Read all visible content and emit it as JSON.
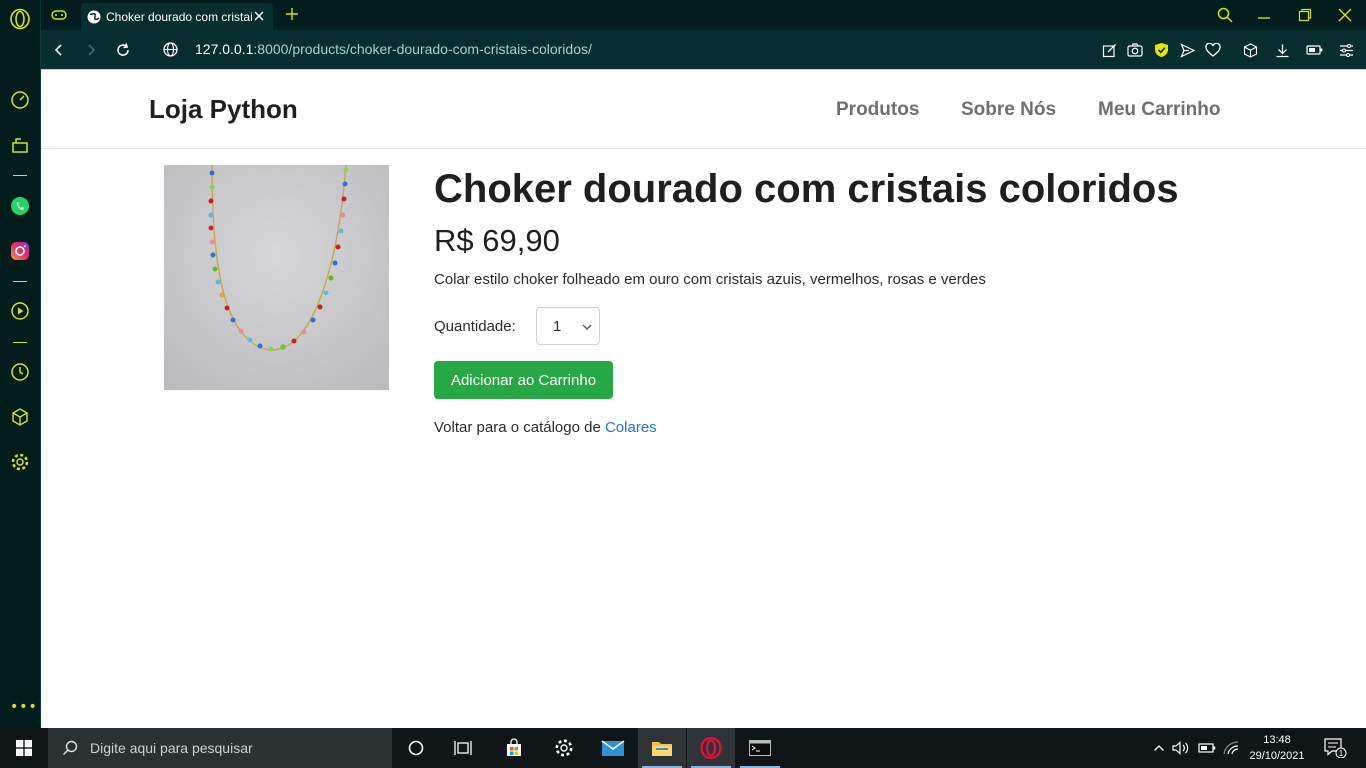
{
  "browser": {
    "tab": {
      "title": "Choker dourado com cristais coloridos"
    },
    "url": {
      "host": "127.0.0.1",
      "path": ":8000/products/choker-dourado-com-cristais-coloridos/"
    }
  },
  "site": {
    "brand": "Loja Python",
    "nav": [
      {
        "label": "Produtos"
      },
      {
        "label": "Sobre Nós"
      },
      {
        "label": "Meu Carrinho"
      }
    ]
  },
  "product": {
    "title": "Choker dourado com cristais coloridos",
    "price": "R$ 69,90",
    "description": "Colar estilo choker folheado em ouro com cristais azuis, vermelhos, rosas e verdes",
    "quantity_label": "Quantidade:",
    "quantity_value": "1",
    "add_button": "Adicionar ao Carrinho",
    "back_text": "Voltar para o catálogo de ",
    "back_link": "Colares",
    "image_icon": "necklace-image"
  },
  "taskbar": {
    "search_placeholder": "Digite aqui para pesquisar",
    "time": "13:48",
    "date": "29/10/2021",
    "notification_count": "1"
  },
  "colors": {
    "browser_dark": "#031d1d",
    "browser_accent": "#d6e320",
    "add_button": "#28a745",
    "link": "#1a73e8"
  }
}
